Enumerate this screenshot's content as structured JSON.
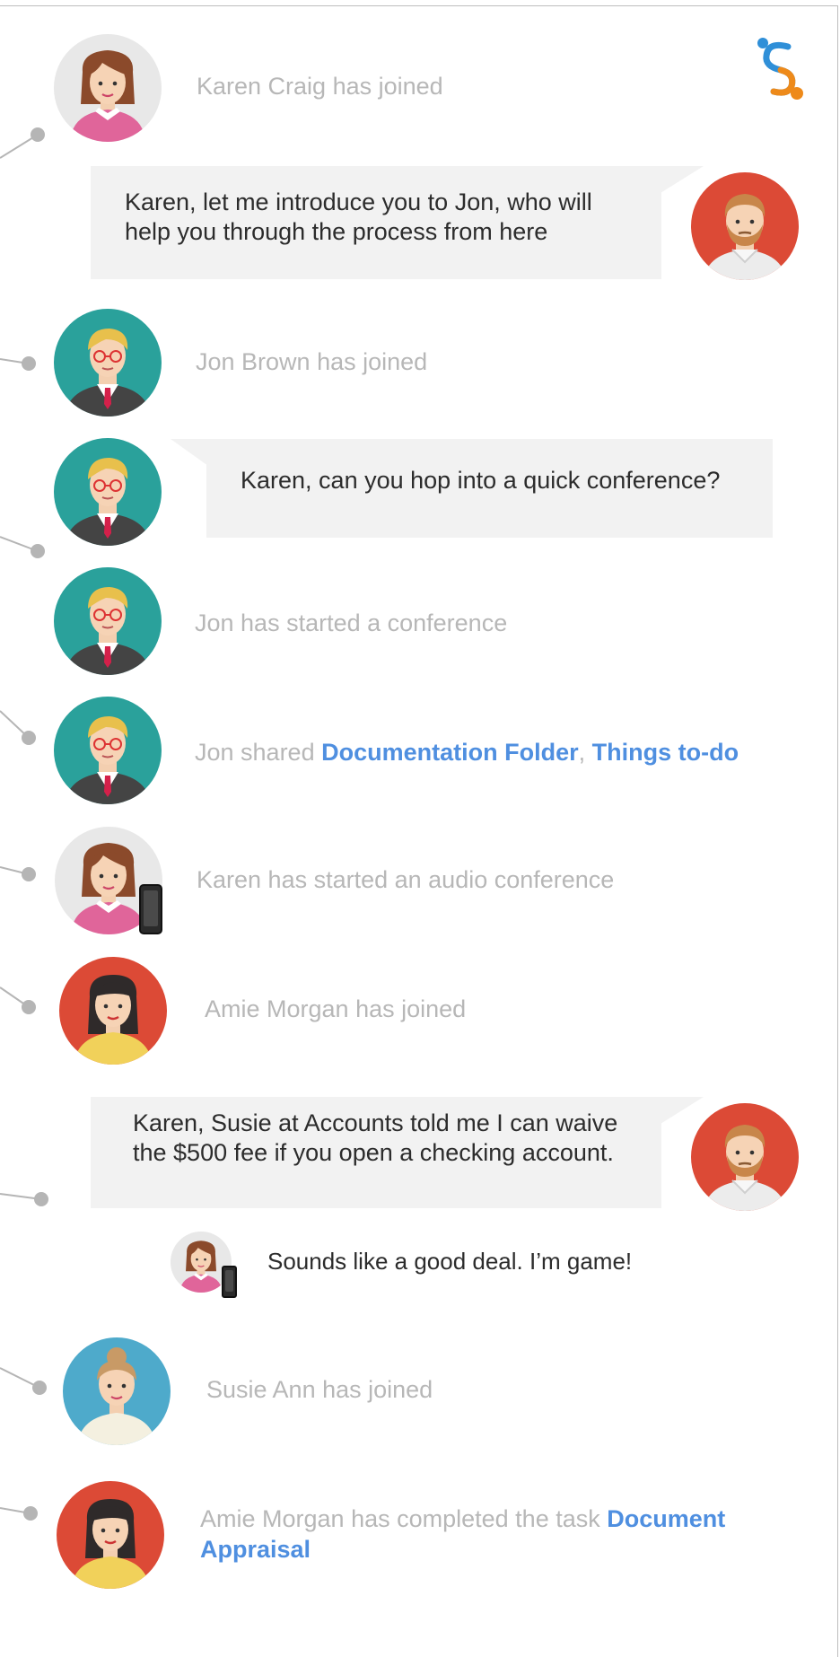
{
  "feed": {
    "e1": "Karen Craig has joined",
    "m1": "Karen, let me introduce you to Jon, who will help you through the process from here",
    "e2": "Jon Brown has joined",
    "m2": "Karen, can you hop into a quick conference?",
    "e3": "Jon has started a conference",
    "e4_prefix": "Jon shared ",
    "e4_link1": "Documentation Folder",
    "e4_sep": ", ",
    "e4_link2": "Things to-do",
    "e5": "Karen has started an audio conference",
    "e6": "Amie Morgan has joined",
    "m3": "Karen,  Susie at Accounts told me I can waive the $500 fee if you open a checking account.",
    "m4": "Sounds like a good deal. I’m game!",
    "e7": "Susie Ann has joined",
    "e8_prefix": "Amie Morgan has completed the task ",
    "e8_link": "Document Appraisal"
  },
  "colors": {
    "event_text": "#b7b7b7",
    "link": "#4f8fe0",
    "bubble_bg": "#f2f2f2",
    "connector": "#b5b5b5"
  }
}
